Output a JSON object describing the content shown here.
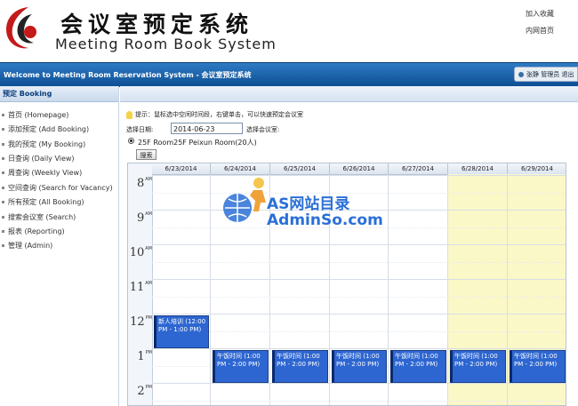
{
  "header": {
    "title_cn": "会议室预定系统",
    "title_en": "Meeting Room Book System",
    "link_favorite": "加入收藏",
    "link_home": "内网首页"
  },
  "topbar": {
    "welcome": "Welcome to Meeting Room Reservation System - 会议室预定系统",
    "user": "张静 管理员 退出"
  },
  "sidebar": {
    "title": "预定 Booking",
    "items": [
      {
        "label": "首页 (Homepage)"
      },
      {
        "label": "添加预定 (Add Booking)"
      },
      {
        "label": "我的预定 (My Booking)"
      },
      {
        "label": "日查询 (Daily View)"
      },
      {
        "label": "周查询 (Weekly View)"
      },
      {
        "label": "空间查询 (Search for Vacancy)"
      },
      {
        "label": "所有预定 (All Booking)"
      },
      {
        "label": "搜索会议室 (Search)"
      },
      {
        "label": "报表 (Reporting)"
      },
      {
        "label": "管理 (Admin)"
      }
    ]
  },
  "filters": {
    "tip": "提示：鼠标选中空闲时间段，右键单击，可以快速预定会议室",
    "date_label": "选择日期:",
    "date_value": "2014-06-23",
    "room_label": "选择会议室:",
    "room_option": "25F Room25F Peixun Room(20人)",
    "search_button": "搜索"
  },
  "calendar": {
    "days": [
      "6/23/2014",
      "6/24/2014",
      "6/25/2014",
      "6/26/2014",
      "6/27/2014",
      "6/28/2014",
      "6/29/2014"
    ],
    "weekend_color": "#fbf8c8",
    "hours": [
      {
        "h": "8",
        "ap": "AM"
      },
      {
        "h": "9",
        "ap": "AM"
      },
      {
        "h": "10",
        "ap": "AM"
      },
      {
        "h": "11",
        "ap": "AM"
      },
      {
        "h": "12",
        "ap": "PM"
      },
      {
        "h": "1",
        "ap": "PM"
      },
      {
        "h": "2",
        "ap": "PM"
      }
    ],
    "events": [
      {
        "day": 0,
        "text": "新人培训 (12:00 PM - 1:00 PM)"
      },
      {
        "day": 1,
        "text": "午饭时间 (1:00 PM - 2:00 PM)"
      },
      {
        "day": 2,
        "text": "午饭时间 (1:00 PM - 2:00 PM)"
      },
      {
        "day": 3,
        "text": "午饭时间 (1:00 PM - 2:00 PM)"
      },
      {
        "day": 4,
        "text": "午饭时间 (1:00 PM - 2:00 PM)"
      },
      {
        "day": 5,
        "text": "午饭时间 (1:00 PM - 2:00 PM)"
      },
      {
        "day": 6,
        "text": "午饭时间 (1:00 PM - 2:00 PM)"
      }
    ],
    "event_color": "#2d66d1"
  },
  "watermark": {
    "line1": "AS网站目录",
    "line2": "AdminSo.com"
  }
}
